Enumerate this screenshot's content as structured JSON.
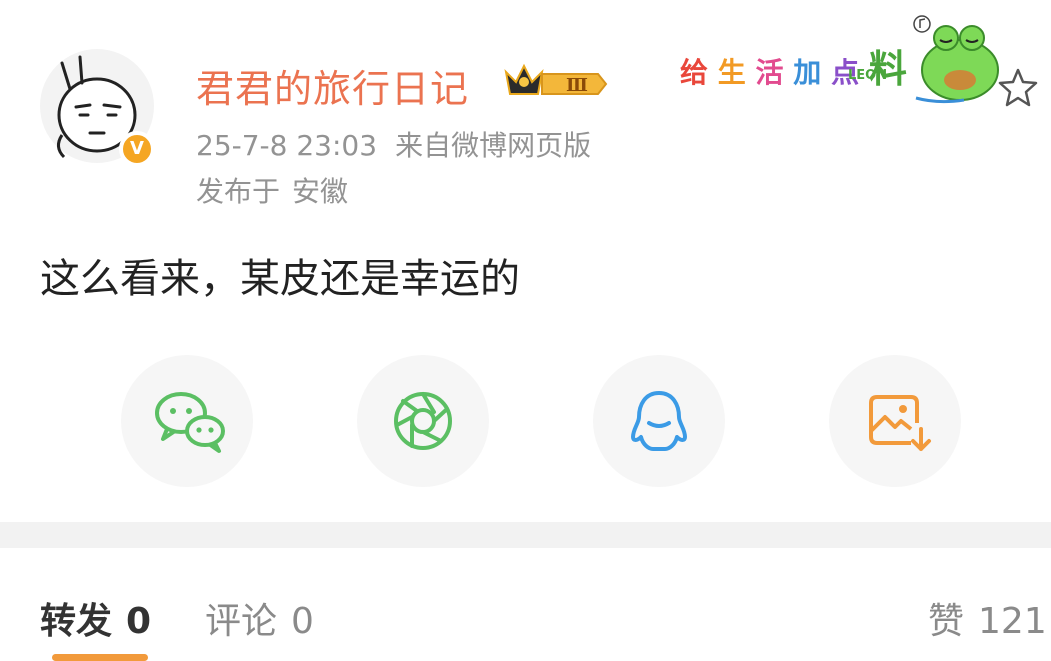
{
  "post": {
    "author": "君君的旅行日记",
    "verified_badge": "V",
    "level_badge": "Ⅲ",
    "date": "25-7-8 23:03",
    "source": "来自微博网页版",
    "location_prefix": "发布于",
    "location": "安徽",
    "text": "这么看来，某皮还是幸运的",
    "sticker": {
      "chars": [
        "给",
        "生",
        "活",
        "加",
        "点",
        "料"
      ],
      "colors": [
        "#e9473b",
        "#f29a24",
        "#e24b8f",
        "#3a8fd8",
        "#8a4fc9",
        "#4aa63c"
      ],
      "sub": "LEON"
    }
  },
  "share": [
    {
      "name": "wechat",
      "icon": "wechat-icon",
      "color": "#5bbf63"
    },
    {
      "name": "moments",
      "icon": "moments-icon",
      "color": "#5bbf63"
    },
    {
      "name": "qq",
      "icon": "qq-icon",
      "color": "#3b9be6"
    },
    {
      "name": "save-image",
      "icon": "save-image-icon",
      "color": "#f29a3b"
    }
  ],
  "tabs": {
    "repost_label": "转发",
    "repost_count": "0",
    "comment_label": "评论",
    "comment_count": "0",
    "like_label": "赞",
    "like_count": "121"
  },
  "colors": {
    "username": "#eb7350",
    "meta": "#939393",
    "accent": "#f29a3b",
    "divider": "#f2f2f2"
  }
}
